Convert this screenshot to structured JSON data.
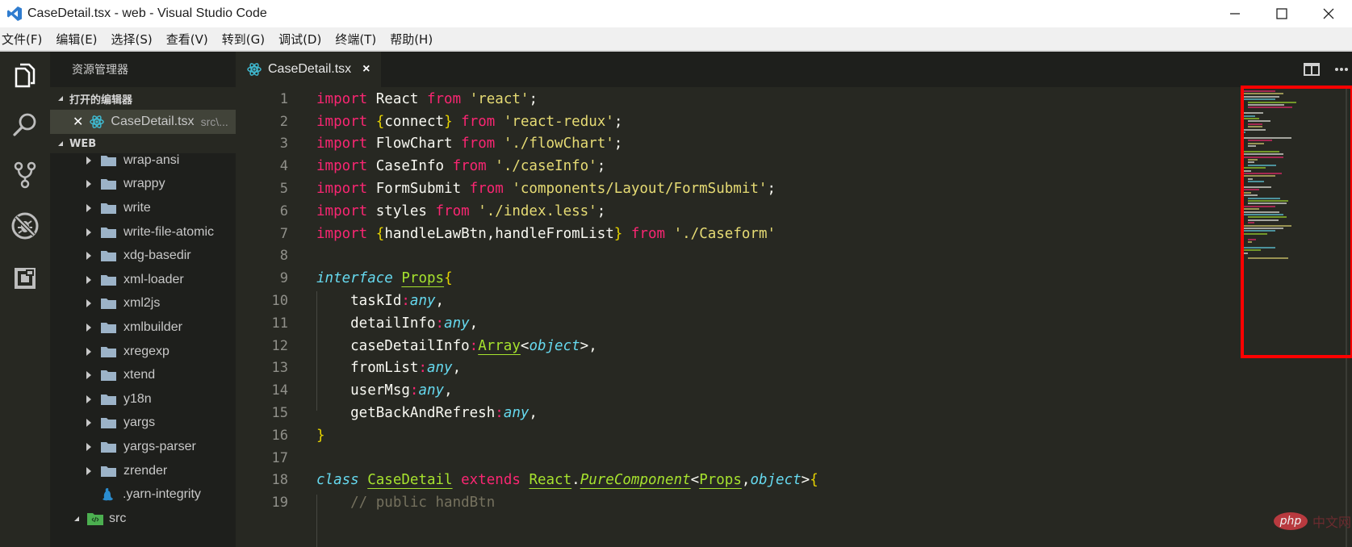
{
  "window": {
    "title": "CaseDetail.tsx - web - Visual Studio Code",
    "controls": [
      "minimize",
      "maximize",
      "close"
    ]
  },
  "menubar": {
    "items": [
      "文件(F)",
      "编辑(E)",
      "选择(S)",
      "查看(V)",
      "转到(G)",
      "调试(D)",
      "终端(T)",
      "帮助(H)"
    ]
  },
  "activitybar": {
    "icons": [
      "explorer-icon",
      "search-icon",
      "source-control-icon",
      "debug-icon",
      "extensions-icon"
    ]
  },
  "sidebar": {
    "title": "资源管理器",
    "open_editors_label": "打开的编辑器",
    "open_editors": [
      {
        "name": "CaseDetail.tsx",
        "path": "src\\..."
      }
    ],
    "workspace_label": "WEB",
    "tree": [
      {
        "name": "wrap-ansi",
        "type": "folder"
      },
      {
        "name": "wrappy",
        "type": "folder"
      },
      {
        "name": "write",
        "type": "folder"
      },
      {
        "name": "write-file-atomic",
        "type": "folder"
      },
      {
        "name": "xdg-basedir",
        "type": "folder"
      },
      {
        "name": "xml-loader",
        "type": "folder"
      },
      {
        "name": "xml2js",
        "type": "folder"
      },
      {
        "name": "xmlbuilder",
        "type": "folder"
      },
      {
        "name": "xregexp",
        "type": "folder"
      },
      {
        "name": "xtend",
        "type": "folder"
      },
      {
        "name": "y18n",
        "type": "folder"
      },
      {
        "name": "yargs",
        "type": "folder"
      },
      {
        "name": "yargs-parser",
        "type": "folder"
      },
      {
        "name": "zrender",
        "type": "folder"
      },
      {
        "name": ".yarn-integrity",
        "type": "file"
      },
      {
        "name": "src",
        "type": "root-folder"
      }
    ]
  },
  "editor": {
    "tab": {
      "label": "CaseDetail.tsx",
      "close": "×"
    },
    "lines": [
      {
        "n": "1",
        "tokens": [
          [
            "kw",
            "import"
          ],
          [
            "p",
            " React "
          ],
          [
            "kw",
            "from"
          ],
          [
            "p",
            " "
          ],
          [
            "str",
            "'react'"
          ],
          [
            "p",
            ";"
          ]
        ]
      },
      {
        "n": "2",
        "tokens": [
          [
            "kw",
            "import"
          ],
          [
            "p",
            " "
          ],
          [
            "br",
            "{"
          ],
          [
            "p",
            "connect"
          ],
          [
            "br",
            "}"
          ],
          [
            "p",
            " "
          ],
          [
            "kw",
            "from"
          ],
          [
            "p",
            " "
          ],
          [
            "str",
            "'react-redux'"
          ],
          [
            "p",
            ";"
          ]
        ]
      },
      {
        "n": "3",
        "tokens": [
          [
            "kw",
            "import"
          ],
          [
            "p",
            " FlowChart "
          ],
          [
            "kw",
            "from"
          ],
          [
            "p",
            " "
          ],
          [
            "str",
            "'./flowChart'"
          ],
          [
            "p",
            ";"
          ]
        ]
      },
      {
        "n": "4",
        "tokens": [
          [
            "kw",
            "import"
          ],
          [
            "p",
            " CaseInfo "
          ],
          [
            "kw",
            "from"
          ],
          [
            "p",
            " "
          ],
          [
            "str",
            "'./caseInfo'"
          ],
          [
            "p",
            ";"
          ]
        ]
      },
      {
        "n": "5",
        "tokens": [
          [
            "kw",
            "import"
          ],
          [
            "p",
            " FormSubmit "
          ],
          [
            "kw",
            "from"
          ],
          [
            "p",
            " "
          ],
          [
            "str",
            "'components/Layout/FormSubmit'"
          ],
          [
            "p",
            ";"
          ]
        ]
      },
      {
        "n": "6",
        "tokens": [
          [
            "kw",
            "import"
          ],
          [
            "p",
            " styles "
          ],
          [
            "kw",
            "from"
          ],
          [
            "p",
            " "
          ],
          [
            "str",
            "'./index.less'"
          ],
          [
            "p",
            ";"
          ]
        ]
      },
      {
        "n": "7",
        "tokens": [
          [
            "kw",
            "import"
          ],
          [
            "p",
            " "
          ],
          [
            "br",
            "{"
          ],
          [
            "p",
            "handleLawBtn,handleFromList"
          ],
          [
            "br",
            "}"
          ],
          [
            "p",
            " "
          ],
          [
            "kw",
            "from"
          ],
          [
            "p",
            " "
          ],
          [
            "str",
            "'./Caseform'"
          ]
        ]
      },
      {
        "n": "8",
        "tokens": []
      },
      {
        "n": "9",
        "tokens": [
          [
            "ty",
            "interface"
          ],
          [
            "p",
            " "
          ],
          [
            "cls",
            "Props"
          ],
          [
            "br",
            "{"
          ]
        ]
      },
      {
        "n": "10",
        "tokens": [
          [
            "p",
            "    taskId"
          ],
          [
            "colon",
            ":"
          ],
          [
            "ty",
            "any"
          ],
          [
            "p",
            ","
          ]
        ]
      },
      {
        "n": "11",
        "tokens": [
          [
            "p",
            "    detailInfo"
          ],
          [
            "colon",
            ":"
          ],
          [
            "ty",
            "any"
          ],
          [
            "p",
            ","
          ]
        ]
      },
      {
        "n": "12",
        "tokens": [
          [
            "p",
            "    caseDetailInfo"
          ],
          [
            "colon",
            ":"
          ],
          [
            "cls",
            "Array"
          ],
          [
            "p",
            "<"
          ],
          [
            "ty",
            "object"
          ],
          [
            "p",
            ">,"
          ]
        ]
      },
      {
        "n": "13",
        "tokens": [
          [
            "p",
            "    fromList"
          ],
          [
            "colon",
            ":"
          ],
          [
            "ty",
            "any"
          ],
          [
            "p",
            ","
          ]
        ]
      },
      {
        "n": "14",
        "tokens": [
          [
            "p",
            "    userMsg"
          ],
          [
            "colon",
            ":"
          ],
          [
            "ty",
            "any"
          ],
          [
            "p",
            ","
          ]
        ]
      },
      {
        "n": "15",
        "tokens": [
          [
            "p",
            "    getBackAndRefresh"
          ],
          [
            "colon",
            ":"
          ],
          [
            "ty",
            "any"
          ],
          [
            "p",
            ","
          ]
        ]
      },
      {
        "n": "16",
        "tokens": [
          [
            "br",
            "}"
          ]
        ]
      },
      {
        "n": "17",
        "tokens": []
      },
      {
        "n": "18",
        "tokens": [
          [
            "ty",
            "class"
          ],
          [
            "p",
            " "
          ],
          [
            "cls",
            "CaseDetail"
          ],
          [
            "p",
            " "
          ],
          [
            "kw",
            "extends"
          ],
          [
            "p",
            " "
          ],
          [
            "cls",
            "React"
          ],
          [
            "p",
            "."
          ],
          [
            "it-cls",
            "PureComponent"
          ],
          [
            "p",
            "<"
          ],
          [
            "cls",
            "Props"
          ],
          [
            "p",
            ","
          ],
          [
            "ty",
            "object"
          ],
          [
            "p",
            ">"
          ],
          [
            "br",
            "{"
          ]
        ]
      },
      {
        "n": "19",
        "tokens": [
          [
            "com",
            "    // public handBtn"
          ]
        ]
      }
    ]
  },
  "tab_actions": [
    "split-editor-icon",
    "more-actions-icon"
  ],
  "watermark": {
    "badge": "php",
    "text": "中文网"
  },
  "colors": {
    "keyword": "#f92672",
    "string": "#e6db74",
    "type": "#66d9ef",
    "class": "#a6e22e",
    "comment": "#75715e",
    "background": "#272822",
    "annotation": "#ff0000"
  }
}
